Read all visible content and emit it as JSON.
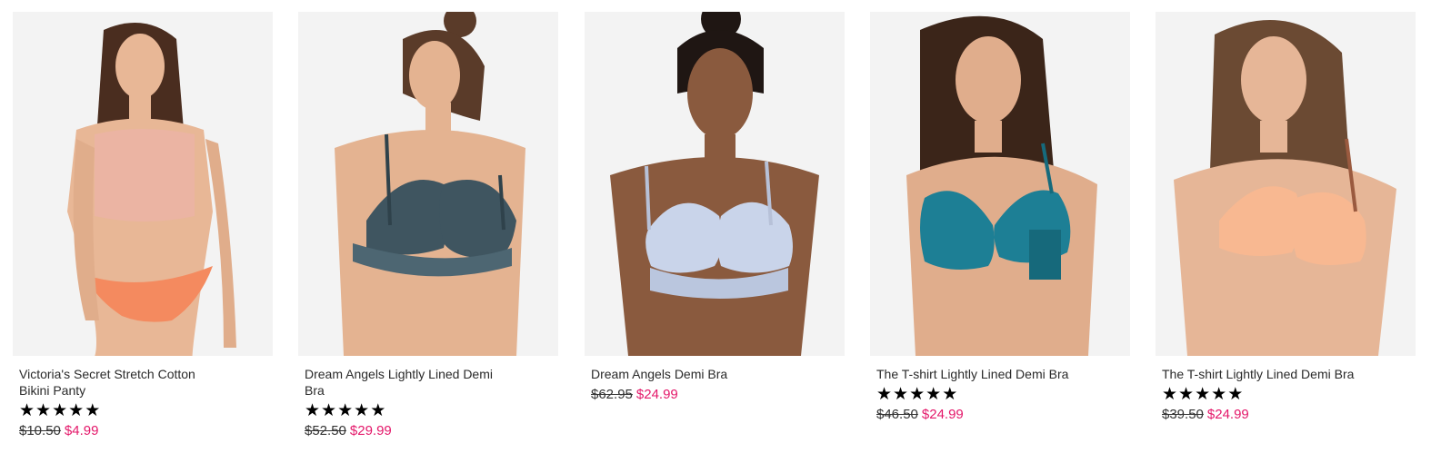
{
  "products": [
    {
      "name": "Victoria's Secret Stretch Cotton Bikini Panty",
      "image": "model-in-crop-top-and-bikini-panty",
      "stars": [
        "★",
        "★",
        "★",
        "★",
        "★"
      ],
      "rating": 5,
      "was_price": "$10.50",
      "now_price": "$4.99",
      "colors": {
        "skin": "#e8b796",
        "top": "#ebb4a3",
        "bottom": "#f48a5f",
        "hair": "#4a2d1f"
      }
    },
    {
      "name": "Dream Angels Lightly Lined Demi Bra",
      "image": "model-in-slate-lace-demi-bra",
      "stars": [
        "★",
        "★",
        "★",
        "★",
        "★"
      ],
      "rating": 5,
      "was_price": "$52.50",
      "now_price": "$29.99",
      "colors": {
        "skin": "#e4b391",
        "top": "#3f5560",
        "hair": "#5a3b29"
      }
    },
    {
      "name": "Dream Angels Demi Bra",
      "image": "model-in-light-blue-lace-demi-bra",
      "stars": [],
      "rating": null,
      "was_price": "$62.95",
      "now_price": "$24.99",
      "colors": {
        "skin": "#8a5a3e",
        "top": "#c9d4ea",
        "hair": "#1f1613"
      }
    },
    {
      "name": "The T-shirt Lightly Lined Demi Bra",
      "image": "model-in-teal-t-shirt-demi-bra",
      "stars": [
        "★",
        "★",
        "★",
        "★",
        "★"
      ],
      "rating": 5,
      "was_price": "$46.50",
      "now_price": "$24.99",
      "colors": {
        "skin": "#e0ad8c",
        "top": "#1d7f95",
        "hair": "#3b2519"
      }
    },
    {
      "name": "The T-shirt Lightly Lined Demi Bra",
      "image": "model-in-peach-t-shirt-demi-bra",
      "stars": [
        "★",
        "★",
        "★",
        "★",
        "★"
      ],
      "rating": 5,
      "was_price": "$39.50",
      "now_price": "$24.99",
      "colors": {
        "skin": "#e6b697",
        "top": "#f8b891",
        "hair": "#6b4a33"
      }
    }
  ]
}
